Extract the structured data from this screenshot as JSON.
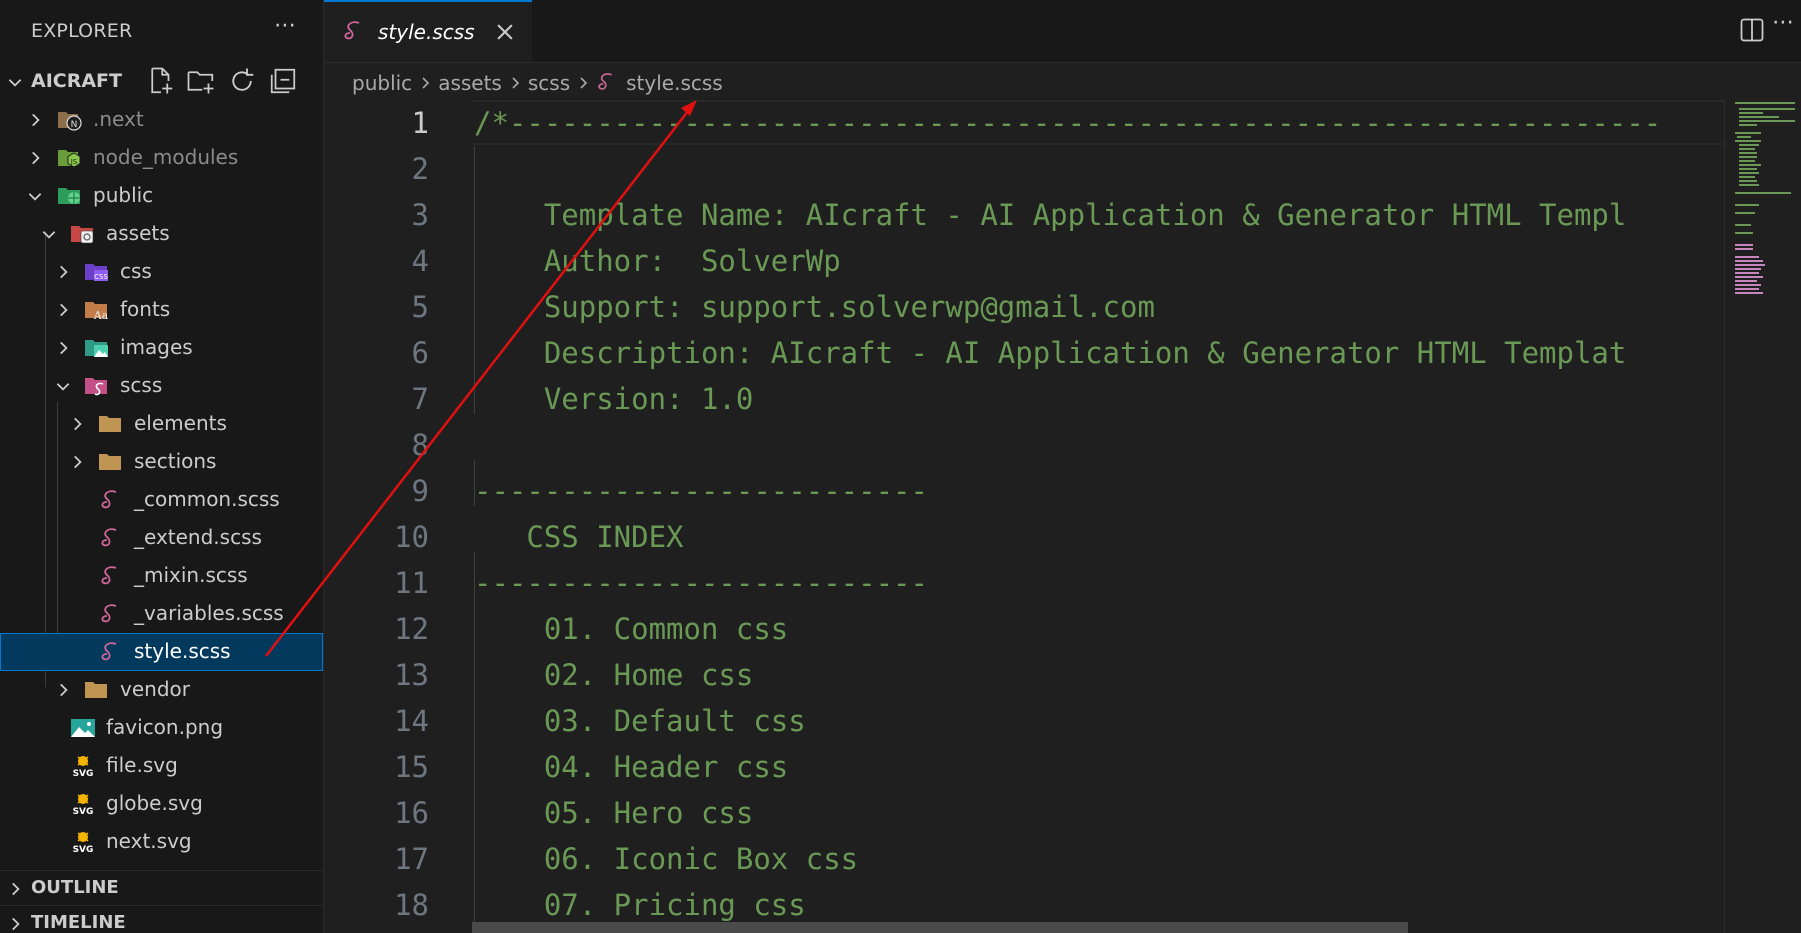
{
  "sidebar": {
    "title": "EXPLORER",
    "project": "AICRAFT",
    "more_icon": "ellipsis-icon",
    "toolbar": [
      "new-file-icon",
      "new-folder-icon",
      "refresh-icon",
      "collapse-all-icon"
    ],
    "tree": [
      {
        "label": ".next",
        "icon": "next-folder-icon"
      },
      {
        "label": "node_modules",
        "icon": "node-folder-icon"
      },
      {
        "label": "public",
        "icon": "public-folder-icon"
      },
      {
        "label": "assets",
        "icon": "assets-folder-icon"
      },
      {
        "label": "css",
        "icon": "css-folder-icon"
      },
      {
        "label": "fonts",
        "icon": "fonts-folder-icon"
      },
      {
        "label": "images",
        "icon": "images-folder-icon"
      },
      {
        "label": "scss",
        "icon": "scss-folder-icon"
      },
      {
        "label": "elements",
        "icon": "folder-icon"
      },
      {
        "label": "sections",
        "icon": "folder-icon"
      },
      {
        "label": "_common.scss",
        "icon": "sass-file-icon"
      },
      {
        "label": "_extend.scss",
        "icon": "sass-file-icon"
      },
      {
        "label": "_mixin.scss",
        "icon": "sass-file-icon"
      },
      {
        "label": "_variables.scss",
        "icon": "sass-file-icon"
      },
      {
        "label": "style.scss",
        "icon": "sass-file-icon",
        "selected": true
      },
      {
        "label": "vendor",
        "icon": "folder-icon"
      },
      {
        "label": "favicon.png",
        "icon": "image-file-icon"
      },
      {
        "label": "file.svg",
        "icon": "svg-file-icon"
      },
      {
        "label": "globe.svg",
        "icon": "svg-file-icon"
      },
      {
        "label": "next.svg",
        "icon": "svg-file-icon"
      }
    ],
    "sections": [
      "OUTLINE",
      "TIMELINE"
    ]
  },
  "editor": {
    "tab": {
      "label": "style.scss",
      "icon": "sass-file-icon",
      "close_icon": "close-icon"
    },
    "actions": [
      "split-editor-icon",
      "ellipsis-icon"
    ],
    "breadcrumb": [
      "public",
      "assets",
      "scss",
      "style.scss"
    ],
    "current_line": 1,
    "lines": [
      {
        "n": "1",
        "text": "/*------------------------------------------------------------------"
      },
      {
        "n": "2",
        "text": ""
      },
      {
        "n": "3",
        "text": "    Template Name: AIcraft - AI Application & Generator HTML Templ"
      },
      {
        "n": "4",
        "text": "    Author:  SolverWp"
      },
      {
        "n": "5",
        "text": "    Support: support.solverwp@gmail.com"
      },
      {
        "n": "6",
        "text": "    Description: AIcraft - AI Application & Generator HTML Templat"
      },
      {
        "n": "7",
        "text": "    Version: 1.0"
      },
      {
        "n": "8",
        "text": ""
      },
      {
        "n": "9",
        "text": "--------------------------"
      },
      {
        "n": "10",
        "text": "   CSS INDEX"
      },
      {
        "n": "11",
        "text": "--------------------------"
      },
      {
        "n": "12",
        "text": "    01. Common css"
      },
      {
        "n": "13",
        "text": "    02. Home css"
      },
      {
        "n": "14",
        "text": "    03. Default css"
      },
      {
        "n": "15",
        "text": "    04. Header css"
      },
      {
        "n": "16",
        "text": "    05. Hero css"
      },
      {
        "n": "17",
        "text": "    06. Iconic Box css"
      },
      {
        "n": "18",
        "text": "    07. Pricing css"
      }
    ]
  },
  "colors": {
    "accent": "#0078d4",
    "comment": "#6a9955",
    "sass_pink": "#cd6799",
    "annotation_arrow": "#e01010"
  }
}
